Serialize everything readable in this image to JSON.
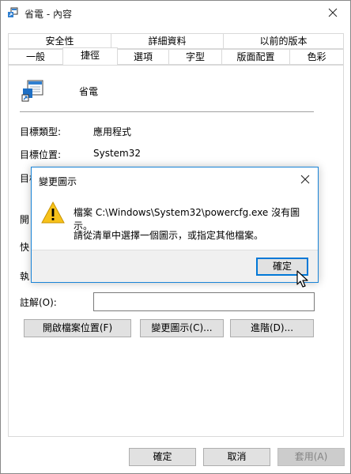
{
  "window": {
    "title": "省電 - 內容"
  },
  "tabs": {
    "row1": [
      "安全性",
      "詳細資料",
      "以前的版本"
    ],
    "row2": [
      "一般",
      "捷徑",
      "選項",
      "字型",
      "版面配置",
      "色彩"
    ],
    "active": "捷徑"
  },
  "shortcut": {
    "name": "省電",
    "target_type_label": "目標類型:",
    "target_type_value": "應用程式",
    "target_location_label": "目標位置:",
    "target_location_value": "System32",
    "target_label_partial": "目標",
    "start_in_partial": "開",
    "shortcut_key_partial": "快",
    "run_partial": "執",
    "comment_label": "註解(O):",
    "comment_value": "",
    "open_location_button": "開啟檔案位置(F)",
    "change_icon_button": "變更圖示(C)...",
    "advanced_button": "進階(D)..."
  },
  "footer": {
    "ok": "確定",
    "cancel": "取消",
    "apply": "套用(A)"
  },
  "dialog": {
    "title": "變更圖示",
    "message1": "檔案 C:\\Windows\\System32\\powercfg.exe 沒有圖示。",
    "message2": "請從清單中選擇一個圖示，或指定其他檔案。",
    "ok": "確定"
  }
}
